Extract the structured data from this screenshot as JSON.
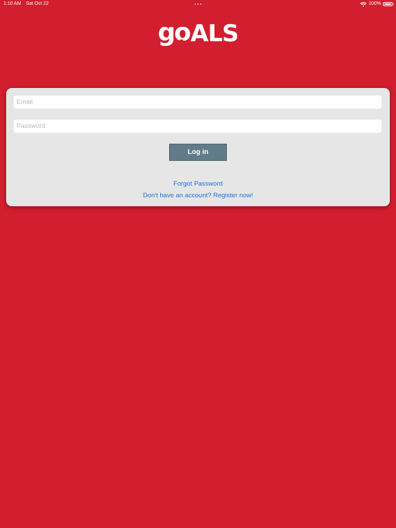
{
  "status_bar": {
    "time": "1:10 AM",
    "date": "Sat Oct 22",
    "battery": "100%",
    "battery_level": 1.0,
    "wifi_icon": "wifi-icon",
    "battery_icon": "battery-icon"
  },
  "logo": {
    "part1": "go",
    "part2": "ALS"
  },
  "login": {
    "email_placeholder": "Email",
    "email_value": "",
    "password_placeholder": "Password",
    "password_value": "",
    "login_label": "Log in",
    "forgot_label": "Forgot Password",
    "register_label": "Don't have an account? Register now!"
  },
  "colors": {
    "background": "#d21e2e",
    "card": "#e6e6e6",
    "button": "#617b89",
    "link": "#1a74d8"
  }
}
